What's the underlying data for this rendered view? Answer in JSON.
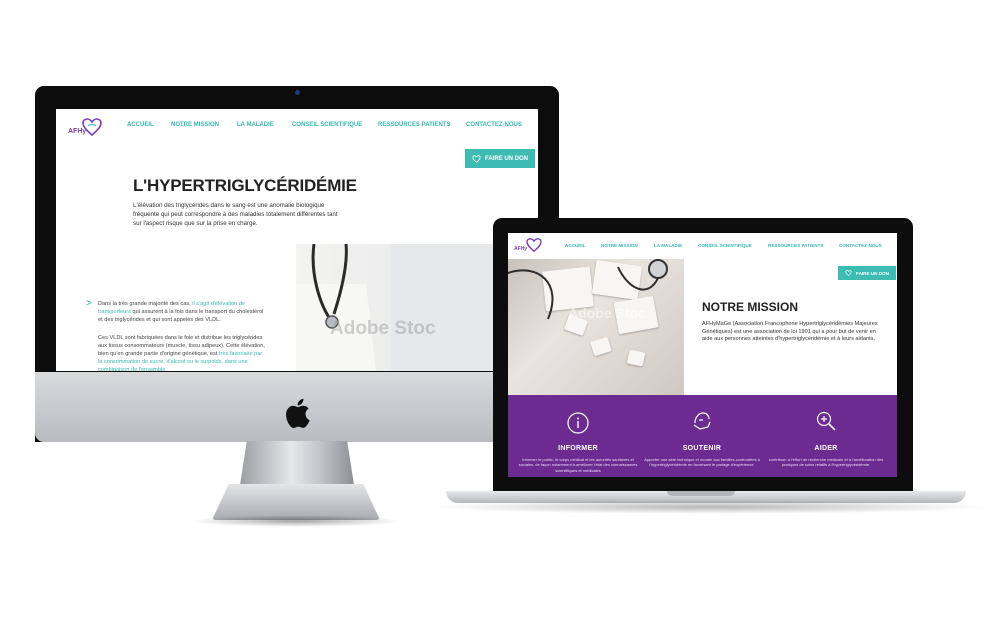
{
  "colors": {
    "teal": "#37b9b0",
    "purple": "#6c2b91",
    "logo_purple": "#7a3fb0"
  },
  "logo": {
    "text": "AFHy"
  },
  "nav": {
    "items": [
      {
        "label": "ACCUEIL"
      },
      {
        "label": "NOTRE MISSION"
      },
      {
        "label": "LA MALADIE"
      },
      {
        "label": "CONSEIL SCIENTIFIQUE"
      },
      {
        "label": "RESSOURCES PATIENTS"
      },
      {
        "label": "CONTACTEZ-NOUS"
      }
    ]
  },
  "donate": {
    "label": "FAIRE UN DON",
    "icon": "heart-icon"
  },
  "imac_page": {
    "title": "L'HYPERTRIGLYCÉRIDÉMIE",
    "intro": "L'élévation des triglycérides dans le sang est une anomalie biologique fréquente qui peut correspondre à des maladies totalement différentes tant sur l'aspect risque que sur la prise en charge.",
    "para1_a": "Dans la très grande majorité des cas, ",
    "para1_hl": "il s'agit d'élévation de transporteurs",
    "para1_b": " qui assurent à la fois dans le transport du cholestérol et des triglycérides et qui sont appelés des VLDL.",
    "para2_a": "Ces VLDL sont fabriquées dans le foie et distribue les triglycérides aux tissus consommateurs (muscle, tissu adipeux). Cette élévation, bien qu'en grande partie d'origine génétique, est ",
    "para2_hl": "très favorisée par la consommation de sucre, d'alcool ou le surpoids, dans une combinaison de l'ensemble",
    "watermark": "Adobe Stoc"
  },
  "macbook_page": {
    "title": "NOTRE MISSION",
    "text": "AFHyMaGe (Association Francophone Hypertriglycéridémies Majeures Génétiques) est une association de loi 1901 qui a pour but de venir en aide aux personnes atteintes d'hypertriglycéridémie et à leurs aidants.",
    "watermark": "Adobe Stoc",
    "columns": [
      {
        "title": "INFORMER",
        "icon": "info-icon",
        "text": "Informer le public, le corps médical et les autorités sanitaires et sociales, de façon notamment à améliorer l'état des connaissances scientifiques et médicales"
      },
      {
        "title": "SOUTENIR",
        "icon": "helping-hand-icon",
        "text": "Apporter une aide technique et morale aux familles confrontées à l'hypertriglycéridémie en favorisant le partage d'expérience."
      },
      {
        "title": "AIDER",
        "icon": "magnifier-plus-icon",
        "text": "contribuer à l'effort de recherche médicale et à l'amélioration des pratiques de soins relatifs à l'hypertriglycéridémie."
      }
    ]
  }
}
